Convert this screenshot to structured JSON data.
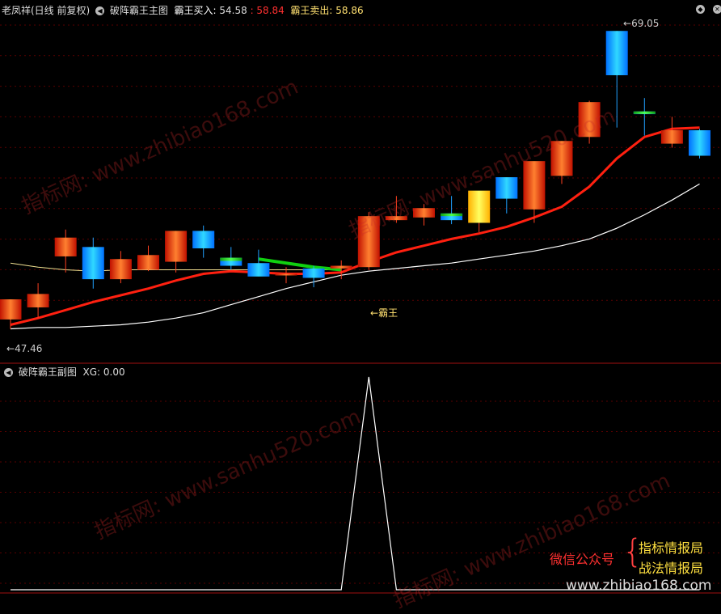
{
  "header": {
    "title": "老凤祥(日线 前复权)",
    "indicator": "破阵霸王主图",
    "buy_label": "霸王买入:",
    "buy_value": "54.58",
    "buy_value2": "58.84",
    "sell_label": "霸王卖出:",
    "sell_value": "58.86"
  },
  "sub_header": {
    "indicator": "破阵霸王副图",
    "xg_label": "XG:",
    "xg_value": "0.00"
  },
  "annotations": {
    "high_label": "69.05",
    "low_label": "47.46",
    "signal_label": "霸王"
  },
  "watermarks": {
    "site1": "指标网: www.zhibiao168.com",
    "site2": "指标网: www.sanhu520.com"
  },
  "promo": {
    "wechat": "微信公众号",
    "name1": "指标情报局",
    "name2": "战法情报局",
    "url": "www.zhibiao168.com"
  },
  "colors": {
    "bg": "#000000",
    "grid": "#5a0000",
    "up": "#e03010",
    "down": "#10a0ff",
    "signal": "#10d010",
    "ma": "#ff2010",
    "line_white": "#ffffff",
    "accent_yellow": "#ffd040"
  },
  "chart_data": [
    {
      "type": "candlestick",
      "ylim": [
        44.7,
        70.2
      ],
      "candles": [
        {
          "o": 47.6,
          "h": 48.5,
          "l": 46.9,
          "c": 49.1,
          "up": true
        },
        {
          "o": 48.5,
          "h": 50.3,
          "l": 47.7,
          "c": 49.5,
          "up": true
        },
        {
          "o": 52.3,
          "h": 54.3,
          "l": 51.1,
          "c": 53.7,
          "up": true
        },
        {
          "o": 53.0,
          "h": 53.7,
          "l": 49.9,
          "c": 50.6,
          "up": false
        },
        {
          "o": 50.6,
          "h": 52.7,
          "l": 50.3,
          "c": 52.1,
          "up": true
        },
        {
          "o": 52.4,
          "h": 53.1,
          "l": 51.2,
          "c": 51.3,
          "up": true
        },
        {
          "o": 51.9,
          "h": 54.2,
          "l": 51.1,
          "c": 54.2,
          "up": true
        },
        {
          "o": 54.2,
          "h": 54.6,
          "l": 52.2,
          "c": 52.9,
          "up": false
        },
        {
          "o": 52.2,
          "h": 53.0,
          "l": 51.3,
          "c": 51.6,
          "up": false,
          "sig": true
        },
        {
          "o": 51.8,
          "h": 52.8,
          "l": 50.9,
          "c": 50.8,
          "up": false
        },
        {
          "o": 51.0,
          "h": 51.5,
          "l": 50.3,
          "c": 51.0,
          "up": true
        },
        {
          "o": 51.4,
          "h": 51.6,
          "l": 50.0,
          "c": 50.7,
          "up": false
        },
        {
          "o": 51.6,
          "h": 52.0,
          "l": 50.6,
          "c": 51.4,
          "up": true
        },
        {
          "o": 51.5,
          "h": 55.6,
          "l": 51.3,
          "c": 55.3,
          "up": true
        },
        {
          "o": 55.0,
          "h": 56.8,
          "l": 54.8,
          "c": 55.3,
          "up": true
        },
        {
          "o": 55.2,
          "h": 56.2,
          "l": 54.6,
          "c": 55.9,
          "up": true
        },
        {
          "o": 55.0,
          "h": 56.8,
          "l": 54.7,
          "c": 55.5,
          "up": false,
          "sig": true
        },
        {
          "o": 54.8,
          "h": 56.8,
          "l": 54.1,
          "c": 57.2,
          "up": true,
          "yellow": true
        },
        {
          "o": 56.6,
          "h": 56.8,
          "l": 55.5,
          "c": 58.2,
          "up": false
        },
        {
          "o": 55.8,
          "h": 58.7,
          "l": 54.8,
          "c": 59.4,
          "up": true
        },
        {
          "o": 58.3,
          "h": 60.9,
          "l": 57.7,
          "c": 60.9,
          "up": true
        },
        {
          "o": 63.8,
          "h": 63.9,
          "l": 60.7,
          "c": 61.2,
          "up": true
        },
        {
          "o": 65.8,
          "h": 69.1,
          "l": 61.9,
          "c": 69.1,
          "up": false
        },
        {
          "o": 63.1,
          "h": 64.1,
          "l": 61.3,
          "c": 62.9,
          "up": false,
          "sig": true
        },
        {
          "o": 60.7,
          "h": 62.7,
          "l": 60.4,
          "c": 61.7,
          "up": true
        },
        {
          "o": 61.7,
          "h": 61.8,
          "l": 59.6,
          "c": 59.8,
          "up": false
        }
      ],
      "ma_red": [
        47.2,
        47.7,
        48.3,
        48.9,
        49.4,
        49.9,
        50.5,
        51.0,
        51.2,
        51.1,
        51.0,
        51.0,
        51.1,
        51.9,
        52.6,
        53.1,
        53.6,
        54.0,
        54.5,
        55.2,
        56.0,
        57.5,
        59.6,
        61.2,
        61.8,
        61.9
      ],
      "ma_white": [
        46.9,
        47.0,
        47.0,
        47.1,
        47.2,
        47.4,
        47.7,
        48.1,
        48.7,
        49.3,
        49.9,
        50.4,
        50.9,
        51.2,
        51.4,
        51.6,
        51.8,
        52.1,
        52.4,
        52.7,
        53.1,
        53.6,
        54.4,
        55.4,
        56.5,
        57.7
      ],
      "ma_yellow": [
        51.8,
        51.5,
        51.3,
        51.2,
        51.3,
        51.3,
        51.3,
        51.3,
        51.3,
        51.3,
        51.3,
        51.3,
        51.3
      ],
      "signal_segment": [
        52.1,
        51.8,
        51.5,
        51.3
      ]
    },
    {
      "type": "line",
      "series_label": "XG",
      "ylim": [
        0,
        1
      ],
      "values": [
        0,
        0,
        0,
        0,
        0,
        0,
        0,
        0,
        0,
        0,
        0,
        0,
        0,
        1,
        0,
        0,
        0,
        0,
        0,
        0,
        0,
        0,
        0,
        0,
        0,
        0
      ]
    }
  ]
}
